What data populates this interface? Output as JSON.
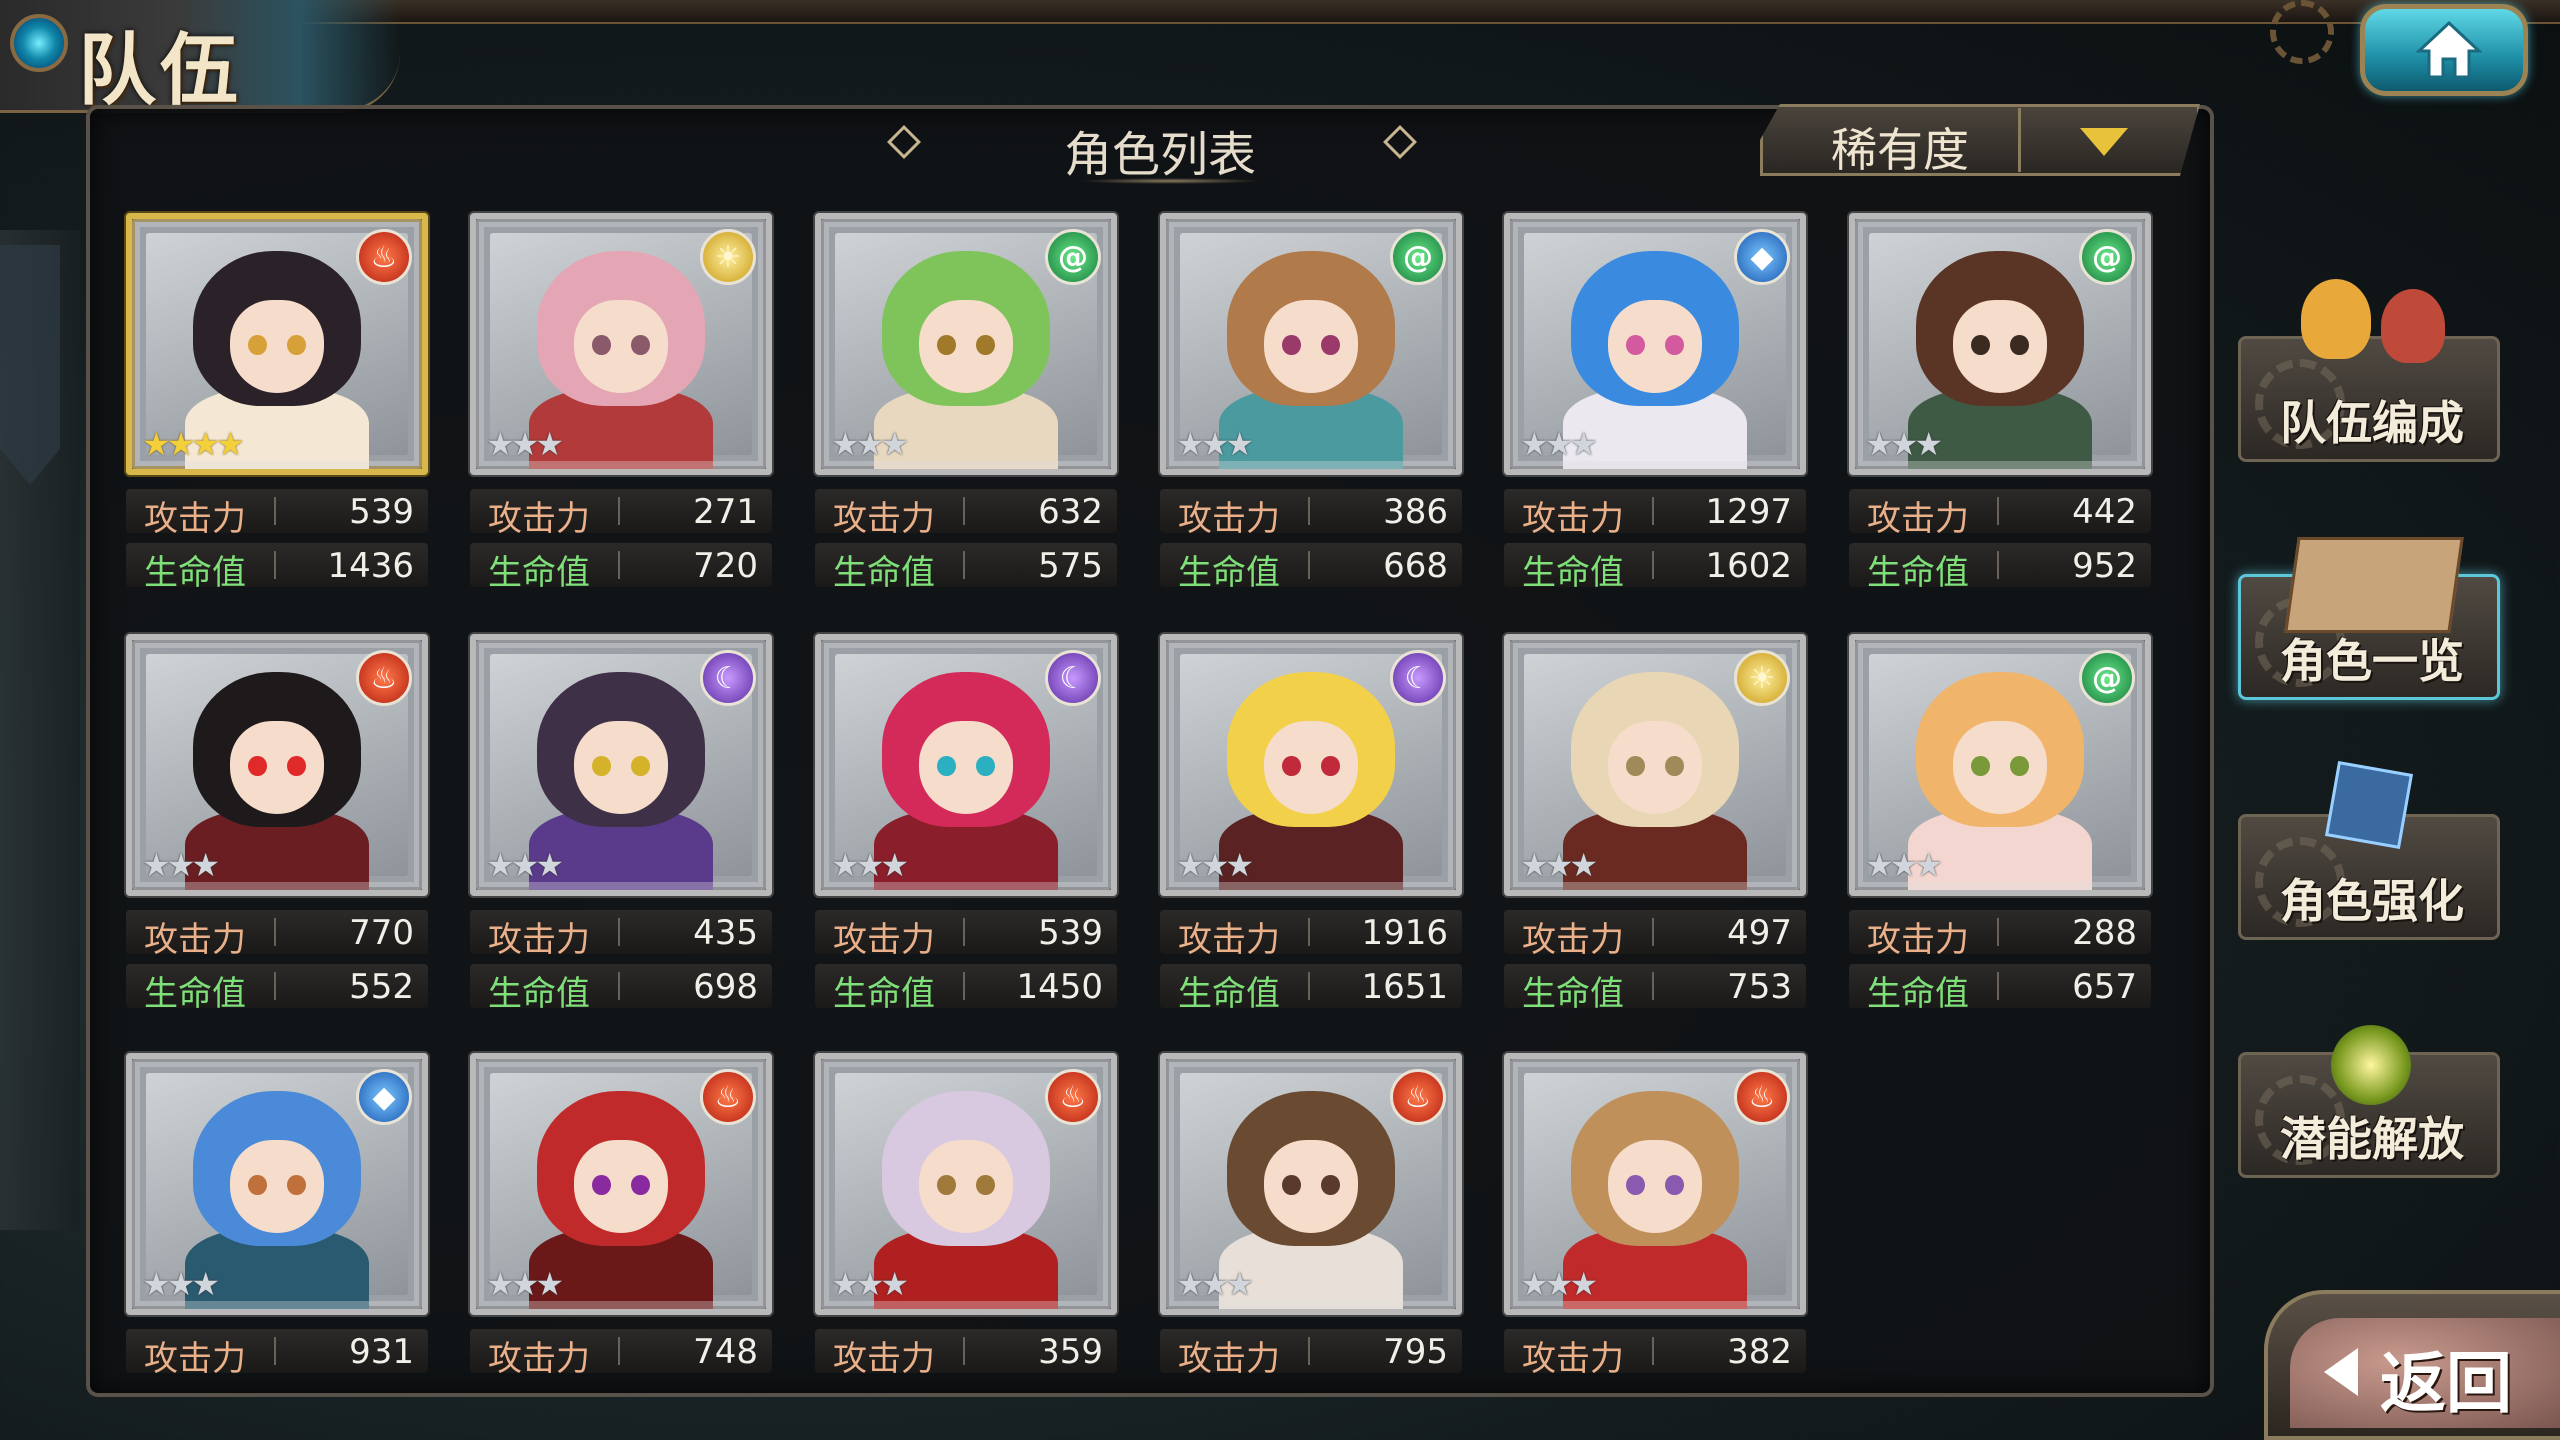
{
  "header": {
    "title": "队伍"
  },
  "panel": {
    "title": "角色列表"
  },
  "sort": {
    "label": "稀有度"
  },
  "labels": {
    "atk": "攻击力",
    "hp": "生命值"
  },
  "side_menu": [
    {
      "label": "队伍编成",
      "icon": "team-members-icon"
    },
    {
      "label": "角色一览",
      "icon": "book-icon",
      "active": true
    },
    {
      "label": "角色强化",
      "icon": "power-up-icon"
    },
    {
      "label": "潜能解放",
      "icon": "potential-orb-icon"
    }
  ],
  "back_label": "返回",
  "characters": [
    {
      "element": "fire",
      "rarity": 4,
      "atk": "539",
      "hp": "1436",
      "hair": "#2a2228",
      "eye": "#d7a13a",
      "outfit": "#f4e8d4"
    },
    {
      "element": "light",
      "rarity": 3,
      "atk": "271",
      "hp": "720",
      "hair": "#e4a6b4",
      "eye": "#8a5a6a",
      "outfit": "#b23a3a"
    },
    {
      "element": "wind",
      "rarity": 3,
      "atk": "632",
      "hp": "575",
      "hair": "#7ec45a",
      "eye": "#a07a2a",
      "outfit": "#e8d8c0"
    },
    {
      "element": "wind",
      "rarity": 3,
      "atk": "386",
      "hp": "668",
      "hair": "#b07a4a",
      "eye": "#9a3a6a",
      "outfit": "#4a9aa0"
    },
    {
      "element": "water",
      "rarity": 3,
      "atk": "1297",
      "hp": "1602",
      "hair": "#3a8ae0",
      "eye": "#d45aa0",
      "outfit": "#ece8f0"
    },
    {
      "element": "wind",
      "rarity": 3,
      "atk": "442",
      "hp": "952",
      "hair": "#5a3424",
      "eye": "#3a2a20",
      "outfit": "#3e5a44"
    },
    {
      "element": "fire",
      "rarity": 3,
      "atk": "770",
      "hp": "552",
      "hair": "#1e1a1c",
      "eye": "#e02a2a",
      "outfit": "#6a1e22"
    },
    {
      "element": "dark",
      "rarity": 3,
      "atk": "435",
      "hp": "698",
      "hair": "#3e3046",
      "eye": "#d4b22a",
      "outfit": "#5a3a8a"
    },
    {
      "element": "dark",
      "rarity": 3,
      "atk": "539",
      "hp": "1450",
      "hair": "#d42a5a",
      "eye": "#2ab0c0",
      "outfit": "#8a1e2a"
    },
    {
      "element": "dark",
      "rarity": 3,
      "atk": "1916",
      "hp": "1651",
      "hair": "#f2d04a",
      "eye": "#c02a3a",
      "outfit": "#5a2222"
    },
    {
      "element": "light",
      "rarity": 3,
      "atk": "497",
      "hp": "753",
      "hair": "#e8d6b4",
      "eye": "#a08a5a",
      "outfit": "#6a2a22"
    },
    {
      "element": "wind",
      "rarity": 3,
      "atk": "288",
      "hp": "657",
      "hair": "#f0b46a",
      "eye": "#7a9a3a",
      "outfit": "#f4d6d0"
    },
    {
      "element": "water",
      "rarity": 3,
      "atk": "931",
      "hp": null,
      "hair": "#4a8ad8",
      "eye": "#c0703a",
      "outfit": "#2a5a70"
    },
    {
      "element": "fire",
      "rarity": 3,
      "atk": "748",
      "hp": null,
      "hair": "#c02a2a",
      "eye": "#8a2aa0",
      "outfit": "#6a1818"
    },
    {
      "element": "fire",
      "rarity": 3,
      "atk": "359",
      "hp": null,
      "hair": "#d8c8e0",
      "eye": "#a07a3a",
      "outfit": "#b02020"
    },
    {
      "element": "fire",
      "rarity": 3,
      "atk": "795",
      "hp": null,
      "hair": "#6a4a30",
      "eye": "#5a3a2a",
      "outfit": "#e8e0d8"
    },
    {
      "element": "fire",
      "rarity": 3,
      "atk": "382",
      "hp": null,
      "hair": "#c0905a",
      "eye": "#8a5ab0",
      "outfit": "#c02a2a"
    }
  ]
}
